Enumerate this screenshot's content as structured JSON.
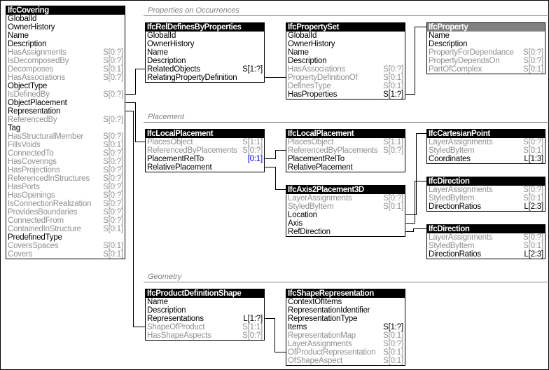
{
  "sections": [
    {
      "label": "Properties on Occurrences"
    },
    {
      "label": "Placement"
    },
    {
      "label": "Geometry"
    }
  ],
  "entities": [
    {
      "name": "IfcCovering",
      "rows": [
        [
          "GlobalId",
          ""
        ],
        [
          "OwnerHistory",
          ""
        ],
        [
          "Name",
          ""
        ],
        [
          "Description",
          ""
        ],
        [
          "HasAssignments",
          "S[0:?]",
          1
        ],
        [
          "IsDecomposedBy",
          "S[0:?]",
          1
        ],
        [
          "Decomposes",
          "S[0:1]",
          1
        ],
        [
          "HasAssociations",
          "S[0:?]",
          1
        ],
        [
          "ObjectType",
          ""
        ],
        [
          "IsDefinedBy",
          "S[0:?]",
          1
        ],
        [
          "ObjectPlacement",
          ""
        ],
        [
          "Representation",
          ""
        ],
        [
          "ReferencedBy",
          "S[0:?]",
          1
        ],
        [
          "Tag",
          ""
        ],
        [
          "HasStructuralMember",
          "S[0:?]",
          1
        ],
        [
          "FillsVoids",
          "S[0:1]",
          1
        ],
        [
          "ConnectedTo",
          "S[0:?]",
          1
        ],
        [
          "HasCoverings",
          "S[0:?]",
          1
        ],
        [
          "HasProjections",
          "S[0:?]",
          1
        ],
        [
          "ReferencedInStructures",
          "S[0:?]",
          1
        ],
        [
          "HasPorts",
          "S[0:?]",
          1
        ],
        [
          "HasOpenings",
          "S[0:?]",
          1
        ],
        [
          "IsConnectionRealization",
          "S[0:?]",
          1
        ],
        [
          "ProvidesBoundaries",
          "S[0:?]",
          1
        ],
        [
          "ConnectedFrom",
          "S[0:?]",
          1
        ],
        [
          "ContainedInStructure",
          "S[0:1]",
          1
        ],
        [
          "PredefinedType",
          ""
        ],
        [
          "CoversSpaces",
          "S[0:1]",
          1
        ],
        [
          "Covers",
          "S[0:1]",
          1
        ]
      ]
    },
    {
      "name": "IfcRelDefinesByProperties",
      "rows": [
        [
          "GlobalId",
          ""
        ],
        [
          "OwnerHistory",
          ""
        ],
        [
          "Name",
          ""
        ],
        [
          "Description",
          ""
        ],
        [
          "RelatedObjects",
          "S[1:?]"
        ],
        [
          "RelatingPropertyDefinition",
          ""
        ]
      ]
    },
    {
      "name": "IfcPropertySet",
      "rows": [
        [
          "GlobalId",
          ""
        ],
        [
          "OwnerHistory",
          ""
        ],
        [
          "Name",
          ""
        ],
        [
          "Description",
          ""
        ],
        [
          "HasAssociations",
          "S[0:?]",
          1
        ],
        [
          "PropertyDefinitionOf",
          "S[0:1]",
          1
        ],
        [
          "DefinesType",
          "S[0:1]",
          1
        ],
        [
          "HasProperties",
          "S[1:?]"
        ]
      ]
    },
    {
      "name": "IfcProperty",
      "abstract": true,
      "rows": [
        [
          "Name",
          ""
        ],
        [
          "Description",
          ""
        ],
        [
          "PropertyForDependance",
          "S[0:?]",
          1
        ],
        [
          "PropertyDependsOn",
          "S[0:?]",
          1
        ],
        [
          "PartOfComplex",
          "S[0:1]",
          1
        ]
      ]
    },
    {
      "name": "IfcLocalPlacement",
      "rows": [
        [
          "PlacesObject",
          "S[1:1]",
          1
        ],
        [
          "ReferencedByPlacements",
          "S[0:?]",
          1
        ],
        [
          "PlacementRelTo",
          "[0:1]",
          0,
          "blue"
        ],
        [
          "RelativePlacement",
          ""
        ]
      ]
    },
    {
      "name": "IfcLocalPlacement",
      "rows": [
        [
          "PlacesObject",
          "S[1:1]",
          1
        ],
        [
          "ReferencedByPlacements",
          "S[0:?]",
          1
        ],
        [
          "PlacementRelTo",
          ""
        ],
        [
          "RelativePlacement",
          ""
        ]
      ]
    },
    {
      "name": "IfcAxis2Placement3D",
      "rows": [
        [
          "LayerAssignments",
          "S[0:?]",
          1
        ],
        [
          "StyledByItem",
          "S[0:1]",
          1
        ],
        [
          "Location",
          ""
        ],
        [
          "Axis",
          ""
        ],
        [
          "RefDirection",
          ""
        ]
      ]
    },
    {
      "name": "IfcCartesianPoint",
      "rows": [
        [
          "LayerAssignments",
          "S[0:?]",
          1
        ],
        [
          "StyledByItem",
          "S[0:1]",
          1
        ],
        [
          "Coordinates",
          "L[1:3]"
        ]
      ]
    },
    {
      "name": "IfcDirection",
      "rows": [
        [
          "LayerAssignments",
          "S[0:?]",
          1
        ],
        [
          "StyledByItem",
          "S[0:1]",
          1
        ],
        [
          "DirectionRatios",
          "L[2:3]"
        ]
      ]
    },
    {
      "name": "IfcDirection",
      "rows": [
        [
          "LayerAssignments",
          "S[0:?]",
          1
        ],
        [
          "StyledByItem",
          "S[0:1]",
          1
        ],
        [
          "DirectionRatios",
          "L[2:3]"
        ]
      ]
    },
    {
      "name": "IfcProductDefinitionShape",
      "rows": [
        [
          "Name",
          ""
        ],
        [
          "Description",
          ""
        ],
        [
          "Representations",
          "L[1:?]"
        ],
        [
          "ShapeOfProduct",
          "S[1:1]",
          1
        ],
        [
          "HasShapeAspects",
          "S[0:?]",
          1
        ]
      ]
    },
    {
      "name": "IfcShapeRepresentation",
      "rows": [
        [
          "ContextOfItems",
          ""
        ],
        [
          "RepresentationIdentifier",
          ""
        ],
        [
          "RepresentationType",
          ""
        ],
        [
          "Items",
          "S[1:?]"
        ],
        [
          "RepresentationMap",
          "S[0:1]",
          1
        ],
        [
          "LayerAssignments",
          "S[0:?]",
          1
        ],
        [
          "OfProductRepresentation",
          "S[0:1]",
          1
        ],
        [
          "OfShapeAspect",
          "S[0:1]",
          1
        ]
      ]
    }
  ],
  "colors": {
    "header": "#000000",
    "abstract_header": "#808080",
    "inverse_text": "#909090",
    "cardinality_highlight": "#0000ff"
  }
}
